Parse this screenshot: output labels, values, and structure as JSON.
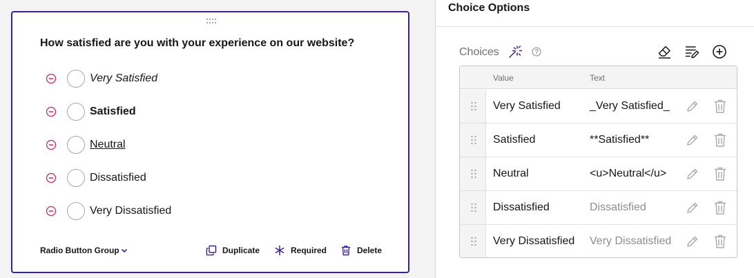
{
  "question": {
    "title": "How satisfied are you with your experience on our website?",
    "choices": [
      {
        "label": "Very Satisfied",
        "style": "italic"
      },
      {
        "label": "Satisfied",
        "style": "bold"
      },
      {
        "label": "Neutral",
        "style": "underline"
      },
      {
        "label": "Dissatisfied",
        "style": "normal"
      },
      {
        "label": "Very Dissatisfied",
        "style": "normal"
      }
    ],
    "type_label": "Radio Button Group",
    "actions": {
      "duplicate": "Duplicate",
      "required": "Required",
      "delete": "Delete"
    }
  },
  "panel": {
    "title": "Choice Options",
    "choices_label": "Choices",
    "table": {
      "headers": {
        "value": "Value",
        "text": "Text"
      },
      "rows": [
        {
          "value": "Very Satisfied",
          "text": "_Very Satisfied_",
          "text_muted": false
        },
        {
          "value": "Satisfied",
          "text": "**Satisfied**",
          "text_muted": false
        },
        {
          "value": "Neutral",
          "text": "<u>Neutral</u>",
          "text_muted": false
        },
        {
          "value": "Dissatisfied",
          "text": "Dissatisfied",
          "text_muted": true
        },
        {
          "value": "Very Dissatisfied",
          "text": "Very Dissatisfied",
          "text_muted": true
        }
      ]
    }
  },
  "colors": {
    "accent": "#3c1f8e",
    "remove": "#d1245d",
    "muted_text": "#8d8d8d",
    "icon_gray": "#a8a8a8"
  },
  "icons": {
    "drag": "drag-dots-icon",
    "remove": "minus-circle-icon",
    "chevron": "chevron-down-icon",
    "duplicate": "copy-icon",
    "required": "asterisk-icon",
    "delete": "trash-icon",
    "magic": "magic-wand-icon",
    "help": "help-icon",
    "clear": "eraser-icon",
    "bulk_edit": "edit-list-icon",
    "add": "plus-circle-icon",
    "edit": "pencil-icon"
  }
}
